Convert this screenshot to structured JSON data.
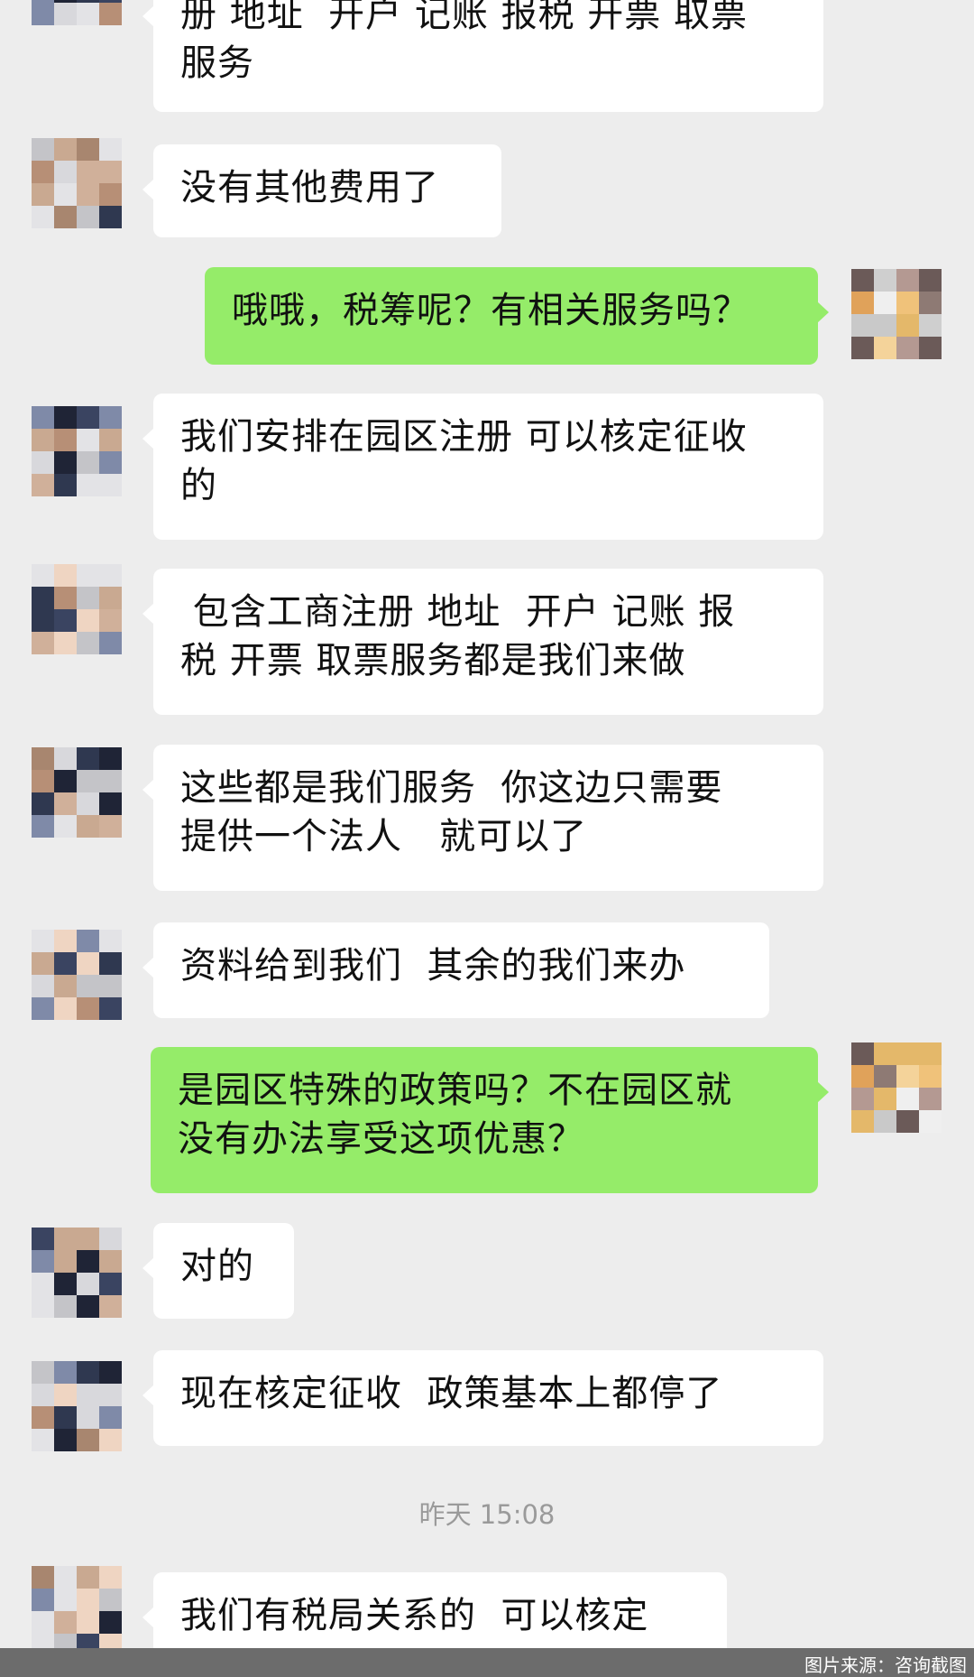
{
  "messages": [
    {
      "side": "in",
      "text": "册 地址  开户 记账 报税 开票 取票\n服务"
    },
    {
      "side": "in",
      "text": "没有其他费用了"
    },
    {
      "side": "out",
      "text": "哦哦，税筹呢？有相关服务吗？"
    },
    {
      "side": "in",
      "text": "我们安排在园区注册 可以核定征收\n的"
    },
    {
      "side": "in",
      "text": " 包含工商注册 地址  开户 记账 报\n税 开票 取票服务都是我们来做"
    },
    {
      "side": "in",
      "text": "这些都是我们服务  你这边只需要\n提供一个法人   就可以了"
    },
    {
      "side": "in",
      "text": "资料给到我们  其余的我们来办"
    },
    {
      "side": "out",
      "text": "是园区特殊的政策吗？不在园区就\n没有办法享受这项优惠？"
    },
    {
      "side": "in",
      "text": "对的"
    },
    {
      "side": "in",
      "text": "现在核定征收  政策基本上都停了"
    },
    {
      "side": "in",
      "text": "我们有税局关系的  可以核定"
    }
  ],
  "timestamp": "昨天 15:08",
  "watermark": "图片来源：咨询截图",
  "colors": {
    "background": "#ededed",
    "incoming_bubble": "#ffffff",
    "outgoing_bubble": "#95ec69"
  }
}
